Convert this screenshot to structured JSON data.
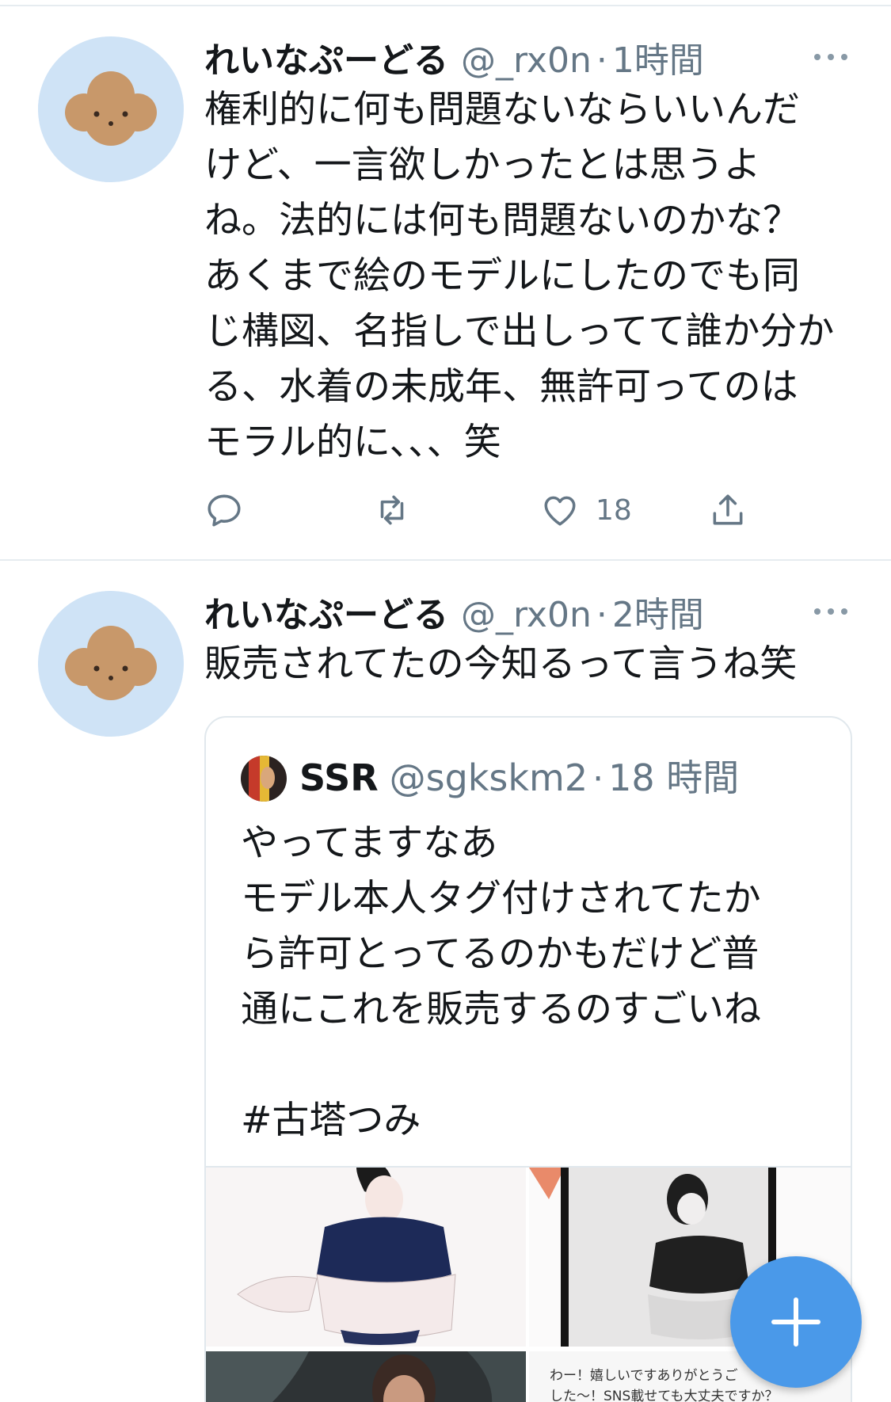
{
  "tweets": [
    {
      "name": "れいなぷーどる",
      "handle": "@_rx0n",
      "separator": "·",
      "time": "1時間",
      "avatar_icon": "poodle-avatar-icon",
      "text": "権利的に何も問題ないならいいんだ\nけど、一言欲しかったとは思うよ\nね。法的には何も問題ないのかな？\nあくまで絵のモデルにしたのでも同\nじ構図、名指しで出しってて誰か分か\nる、水着の未成年、無許可ってのは\nモラル的に、、、笑",
      "actions": {
        "reply_icon": "reply-icon",
        "retweet_icon": "retweet-icon",
        "like_icon": "heart-icon",
        "like_count": "18",
        "share_icon": "share-icon"
      }
    },
    {
      "name": "れいなぷーどる",
      "handle": "@_rx0n",
      "separator": "·",
      "time": "2時間",
      "avatar_icon": "poodle-avatar-icon",
      "text": "販売されてたの今知るって言うね笑"
    }
  ],
  "quoted_tweet": {
    "name": "SSR",
    "handle": "@sgkskm2",
    "separator": "·",
    "time": "18 時間",
    "text": "やってますなあ\nモデル本人タグ付けされてたか\nら許可とってるのかもだけど普\n通にこれを販売するのすごいね\n\n#古塔つみ",
    "media_caption": "わー！嬉しいですありがとうご\nした〜！SNS載せても大丈夫ですか？"
  },
  "fab": {
    "icon": "plus-icon",
    "color": "#4a99e9"
  },
  "colors": {
    "text": "#14171a",
    "muted": "#657786",
    "divider": "#e6ecf0",
    "avatar_bg": "#cfe3f6"
  }
}
